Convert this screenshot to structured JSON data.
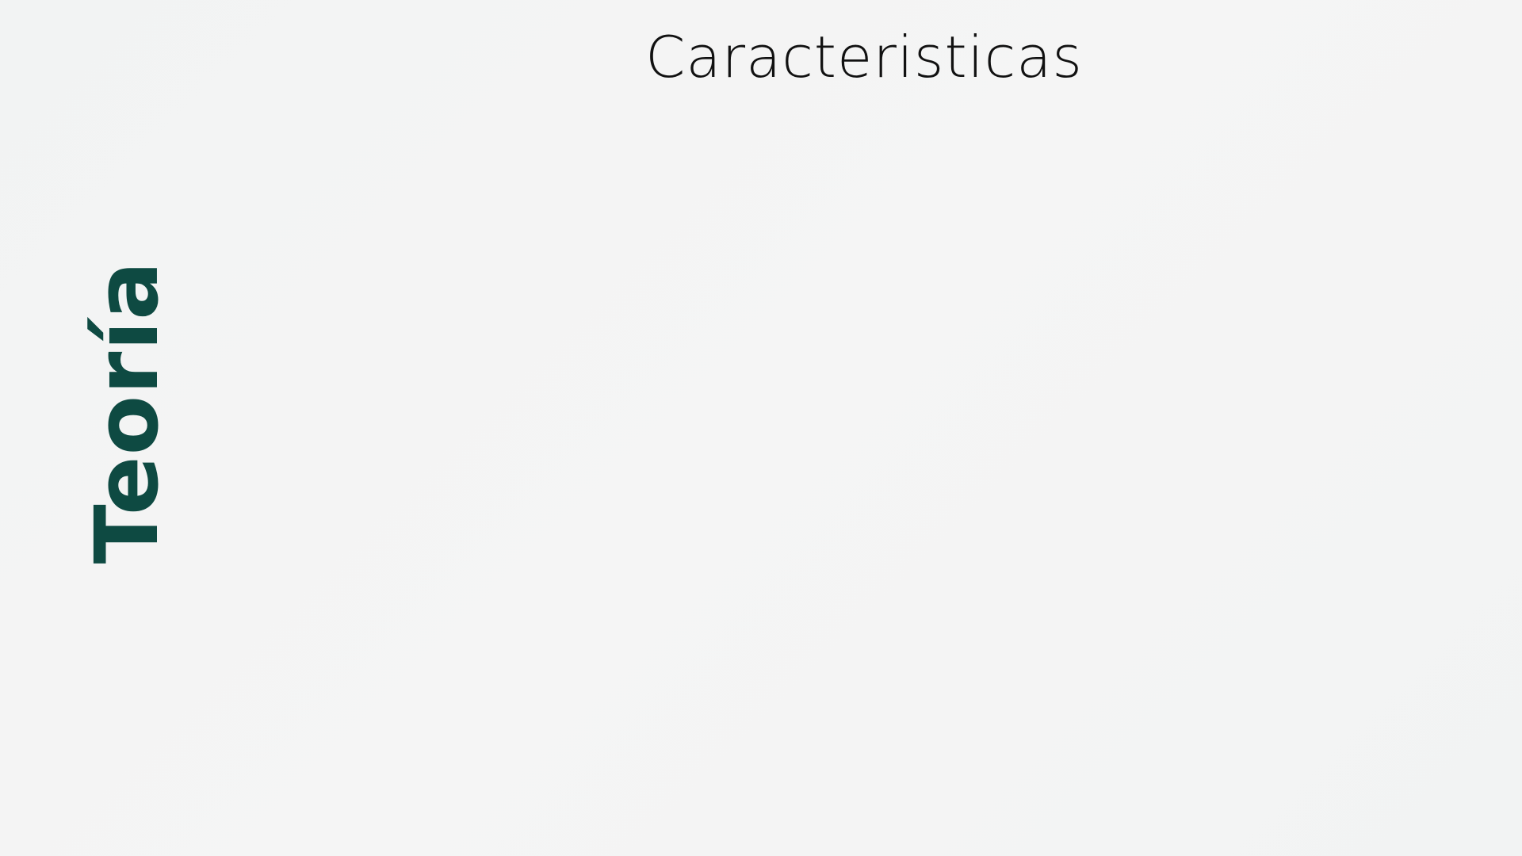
{
  "slide": {
    "title": "Caracteristicas",
    "side_label": "Teoría"
  },
  "colors": {
    "background": "#f3f4f4",
    "title_text": "#111111",
    "side_label_text": "#0e4a42"
  }
}
